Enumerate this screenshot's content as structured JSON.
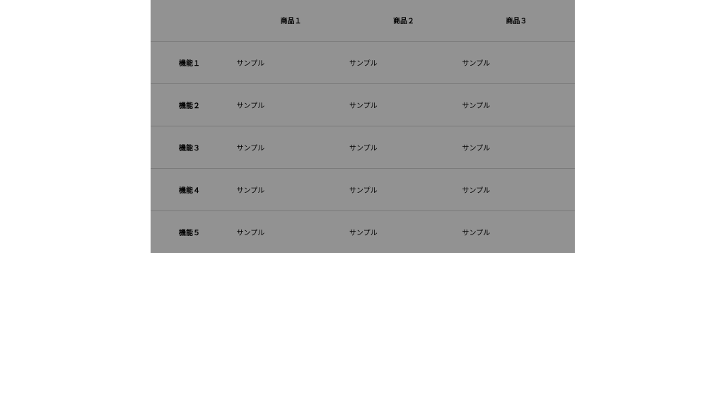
{
  "table": {
    "columns": [
      "商品１",
      "商品２",
      "商品３"
    ],
    "rows": [
      {
        "label": "機能１",
        "cells": [
          "サンプル",
          "サンプル",
          "サンプル"
        ]
      },
      {
        "label": "機能２",
        "cells": [
          "サンプル",
          "サンプル",
          "サンプル"
        ]
      },
      {
        "label": "機能３",
        "cells": [
          "サンプル",
          "サンプル",
          "サンプル"
        ]
      },
      {
        "label": "機能４",
        "cells": [
          "サンプル",
          "サンプル",
          "サンプル"
        ]
      },
      {
        "label": "機能５",
        "cells": [
          "サンプル",
          "サンプル",
          "サンプル"
        ]
      }
    ]
  }
}
